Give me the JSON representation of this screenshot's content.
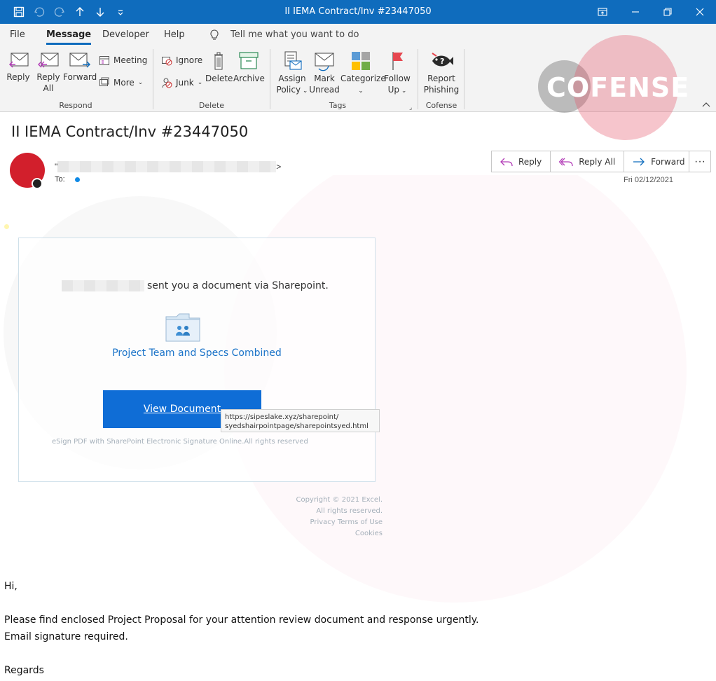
{
  "window": {
    "title": "II IEMA Contract/Inv #23447050"
  },
  "menu": {
    "tabs": [
      "File",
      "Message",
      "Developer",
      "Help"
    ],
    "active": "Message",
    "tell_me": "Tell me what you want to do"
  },
  "ribbon": {
    "respond": {
      "label": "Respond",
      "reply": "Reply",
      "reply_all_1": "Reply",
      "reply_all_2": "All",
      "forward": "Forward",
      "meeting": "Meeting",
      "more": "More"
    },
    "delete": {
      "label": "Delete",
      "ignore": "Ignore",
      "junk": "Junk",
      "delete": "Delete",
      "archive": "Archive"
    },
    "tags": {
      "label": "Tags",
      "assign_1": "Assign",
      "assign_2": "Policy",
      "mark_1": "Mark",
      "mark_2": "Unread",
      "categorize": "Categorize",
      "follow_1": "Follow",
      "follow_2": "Up"
    },
    "cofense": {
      "label": "Cofense",
      "report_1": "Report",
      "report_2": "Phishing"
    }
  },
  "watermark": {
    "logo_text": "COFENSE"
  },
  "message": {
    "subject": "II IEMA Contract/Inv #23447050",
    "sender_prefix": "\"",
    "sender_suffix": ">",
    "to_label": "To:",
    "date": "Fri 02/12/2021",
    "actions": {
      "reply": "Reply",
      "reply_all": "Reply All",
      "forward": "Forward",
      "more": "···"
    }
  },
  "email": {
    "share_text": "sent you a document via Sharepoint.",
    "doc_link": "Project Team and Specs Combined",
    "view_button": "View Document",
    "tooltip_line1": "https://sipeslake.xyz/sharepoint/",
    "tooltip_line2": "syedshairpointpage/sharepointsyed.html",
    "esign": "eSign PDF with SharePoint Electronic Signature Online.All rights reserved",
    "footer": [
      "Copyright © 2021 Excel.",
      "All rights reserved.",
      "Privacy Terms of Use",
      "Cookies"
    ],
    "greeting": "Hi,",
    "line1": "Please find enclosed Project Proposal for your attention review document and response urgently.",
    "line2": "Email signature required.",
    "regards": "Regards"
  },
  "colors": {
    "accent": "#0f6cbd",
    "button": "#0f6dd6",
    "link": "#1a73c8",
    "avatar": "#d21f2c"
  }
}
